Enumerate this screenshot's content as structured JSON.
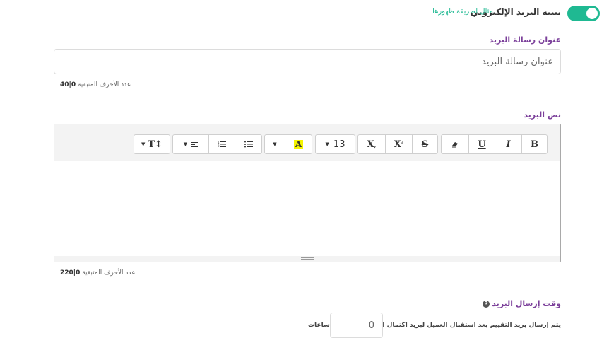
{
  "notification": {
    "toggle_on": true,
    "title": "تنبيه البريد الإلكتروني",
    "example_link": "مثال لطريقة ظهورها"
  },
  "subject": {
    "label": "عنوان رسالة البريد",
    "placeholder": "عنوان رسالة البريد",
    "counter_label": "عدد الأحرف المتبقية",
    "counter_used": "0",
    "counter_sep": "|",
    "counter_max": "40"
  },
  "body": {
    "label": "نص البريد",
    "counter_label": "عدد الأحرف المتبقية",
    "counter_used": "0",
    "counter_sep": "|",
    "counter_max": "220"
  },
  "toolbar": {
    "bold": "B",
    "italic": "I",
    "underline": "U",
    "strikethrough": "S",
    "superscript": "X",
    "superscript_mark": "²",
    "subscript": "X",
    "subscript_mark": ",",
    "font_size": "13",
    "highlight": "A",
    "highlight_color": "#f4f400",
    "paragraph_style": "T↕",
    "caret": "▼"
  },
  "send_time": {
    "label": "وقت إرسال البريد",
    "help_icon": "?",
    "description": "يتم إرسال بريد التقييم بعد استقبال العميل لبريد اكتمال الطلب بـ",
    "value": "0",
    "unit": "ساعات"
  },
  "colors": {
    "accent_green": "#1fb992",
    "label_purple": "#7b3f9a"
  }
}
